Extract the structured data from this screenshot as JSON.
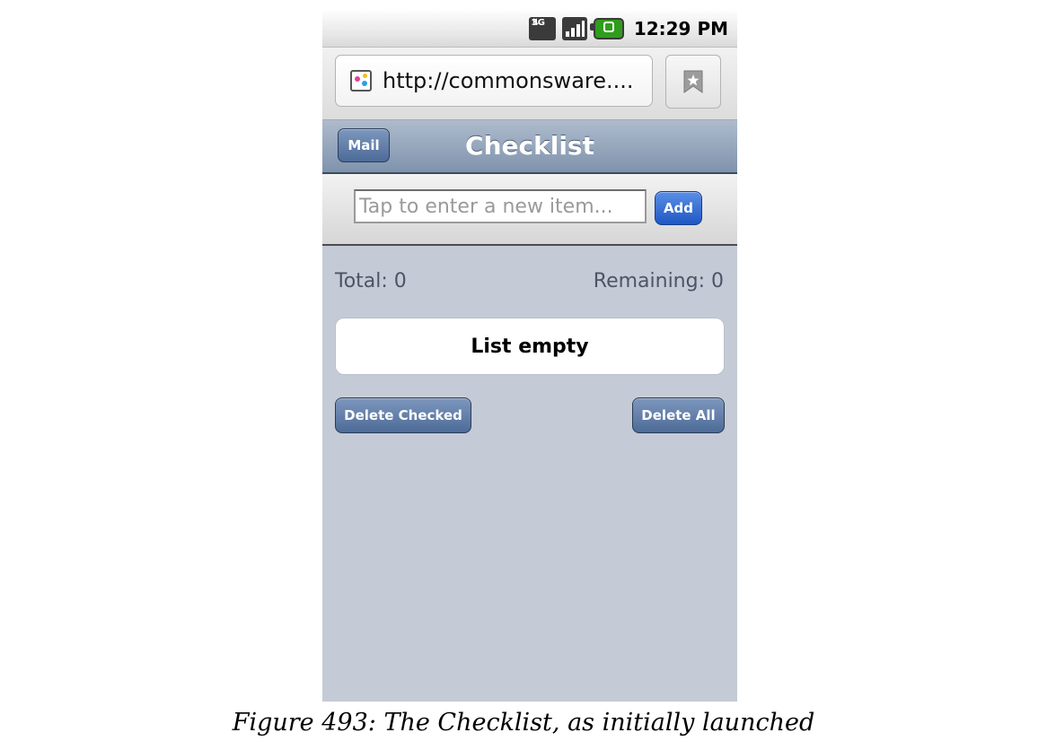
{
  "status_bar": {
    "time": "12:29 PM",
    "network_icon_text": "3G",
    "icons": [
      "3g-data-icon",
      "signal-icon",
      "battery-charging-icon"
    ]
  },
  "browser": {
    "url": "http://commonsware....",
    "favicon": "site-favicon",
    "bookmark_icon": "bookmark-star-icon"
  },
  "app_header": {
    "back_button_label": "Mail",
    "title": "Checklist"
  },
  "new_item": {
    "placeholder": "Tap to enter a new item...",
    "value": "",
    "add_label": "Add"
  },
  "counts": {
    "total": "Total: 0",
    "remaining": "Remaining: 0"
  },
  "list": {
    "empty_text": "List empty",
    "items": []
  },
  "actions": {
    "delete_checked": "Delete Checked",
    "delete_all": "Delete All"
  },
  "caption": "Figure 493: The Checklist, as initially launched",
  "colors": {
    "app_background": "#c5cbd6",
    "header_blue": "#8fa1b9",
    "add_button_blue": "#2f6ad6",
    "battery_green": "#2f9d1b"
  }
}
